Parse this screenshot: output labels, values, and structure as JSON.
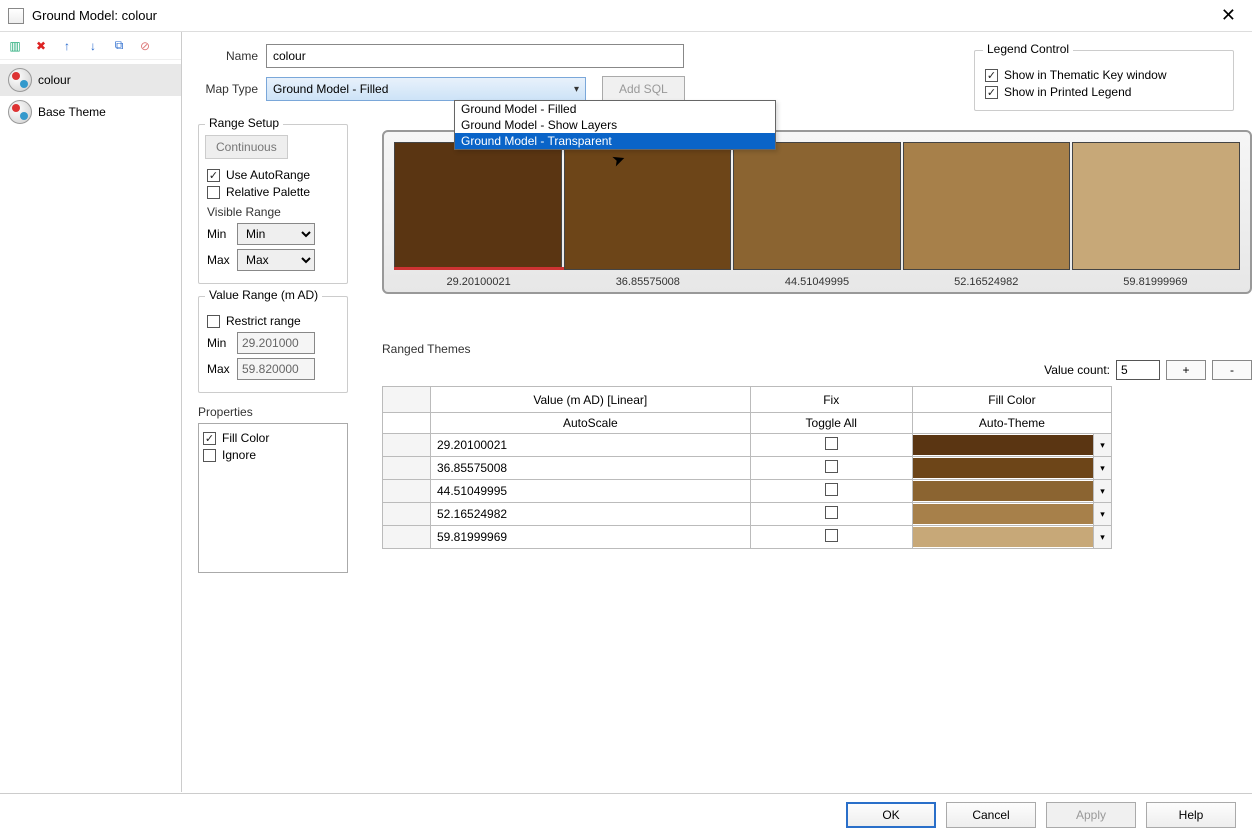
{
  "window": {
    "title": "Ground Model: colour"
  },
  "toolbar_icons": [
    "new",
    "delete",
    "up",
    "down",
    "copy",
    "disable"
  ],
  "tree": [
    {
      "label": "colour",
      "selected": true
    },
    {
      "label": "Base Theme",
      "selected": false
    }
  ],
  "labels": {
    "name": "Name",
    "mapType": "Map Type",
    "addSql": "Add SQL",
    "rangeSetup": "Range Setup",
    "continuous": "Continuous",
    "useAutoRange": "Use AutoRange",
    "relativePalette": "Relative Palette",
    "visibleRange": "Visible Range",
    "min": "Min",
    "max": "Max",
    "valueRange": "Value Range (m AD)",
    "restrictRange": "Restrict range",
    "properties": "Properties",
    "fillColor": "Fill Color",
    "ignore": "Ignore",
    "legendControl": "Legend Control",
    "showThematic": "Show in Thematic Key window",
    "showPrinted": "Show in Printed Legend",
    "rangedThemes": "Ranged Themes",
    "valueCount": "Value count:",
    "colValue": "Value (m AD) [Linear]",
    "colFix": "Fix",
    "colFill": "Fill Color",
    "autoScale": "AutoScale",
    "toggleAll": "Toggle All",
    "autoTheme": "Auto-Theme",
    "ok": "OK",
    "cancel": "Cancel",
    "apply": "Apply",
    "help": "Help"
  },
  "form": {
    "name": "colour",
    "mapType": "Ground Model - Filled",
    "mapTypeOptions": [
      "Ground Model - Filled",
      "Ground Model - Show Layers",
      "Ground Model - Transparent"
    ],
    "mapTypeHighlightIndex": 2,
    "useAutoRange": true,
    "relativePalette": false,
    "visibleMin": "Min",
    "visibleMax": "Max",
    "restrictRange": false,
    "valueMin": "29.201000",
    "valueMax": "59.820000",
    "propFillColor": true,
    "propIgnore": false,
    "showThematic": true,
    "showPrinted": true,
    "valueCount": "5"
  },
  "palette": {
    "ticks": [
      "29.20100021",
      "36.85575008",
      "44.51049995",
      "52.16524982",
      "59.81999969"
    ],
    "colors": [
      "#5a3512",
      "#6d4518",
      "#8b6431",
      "#a7804a",
      "#c7a878"
    ]
  },
  "rows": [
    {
      "value": "29.20100021",
      "fix": false,
      "color": "#5a3512"
    },
    {
      "value": "36.85575008",
      "fix": false,
      "color": "#6d4518"
    },
    {
      "value": "44.51049995",
      "fix": false,
      "color": "#8b6431"
    },
    {
      "value": "52.16524982",
      "fix": false,
      "color": "#a7804a"
    },
    {
      "value": "59.81999969",
      "fix": false,
      "color": "#c7a878"
    }
  ]
}
